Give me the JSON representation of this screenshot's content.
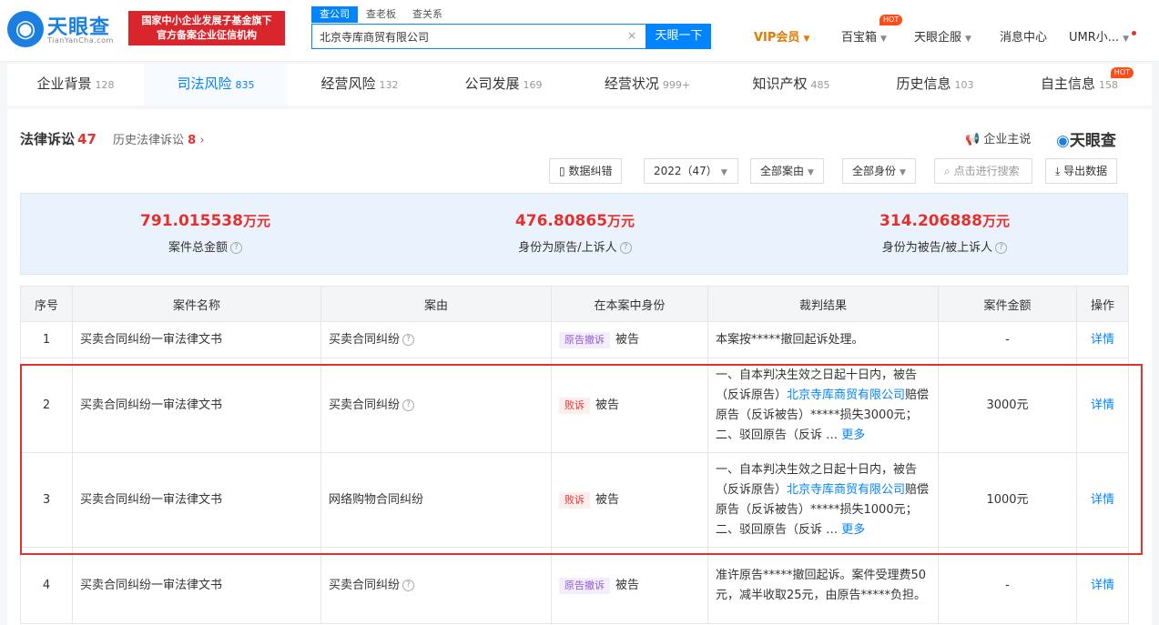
{
  "header": {
    "logo_mark": "◉",
    "logo_text": "天眼查",
    "logo_sub": "TianYanCha.com",
    "badge_line1": "国家中小企业发展子基金旗下",
    "badge_line2": "官方备案企业征信机构",
    "search_tabs": [
      "查公司",
      "查老板",
      "查关系"
    ],
    "search_value": "北京寺库商贸有限公司",
    "search_button": "天眼一下",
    "nav": {
      "vip": "VIP会员",
      "treasure": "百宝箱",
      "hot": "HOT",
      "enterprise": "天眼企服",
      "messages": "消息中心",
      "user": "UMR小..."
    }
  },
  "tabs": [
    {
      "label": "企业背景",
      "count": "128"
    },
    {
      "label": "司法风险",
      "count": "835"
    },
    {
      "label": "经营风险",
      "count": "132"
    },
    {
      "label": "公司发展",
      "count": "169"
    },
    {
      "label": "经营状况",
      "count": "999+"
    },
    {
      "label": "知识产权",
      "count": "485"
    },
    {
      "label": "历史信息",
      "count": "103"
    },
    {
      "label": "自主信息",
      "count": "158",
      "hot": "HOT"
    }
  ],
  "section": {
    "title": "法律诉讼",
    "count": "47",
    "history_label": "历史法律诉讼",
    "history_count": "8",
    "brand_promo": "企业主说",
    "brand_logo": "天眼查"
  },
  "toolbar": {
    "correction": "数据纠错",
    "year": "2022（47）",
    "cause": "全部案由",
    "identity": "全部身份",
    "search_placeholder": "点击进行搜索",
    "export": "导出数据"
  },
  "stats": [
    {
      "value": "791.015538",
      "unit": "万元",
      "label": "案件总金额"
    },
    {
      "value": "476.80865",
      "unit": "万元",
      "label": "身份为原告/上诉人"
    },
    {
      "value": "314.206888",
      "unit": "万元",
      "label": "身份为被告/被上诉人"
    }
  ],
  "table": {
    "headers": [
      "序号",
      "案件名称",
      "案由",
      "在本案中身份",
      "裁判结果",
      "案件金额",
      "操作"
    ],
    "rows": [
      {
        "no": "1",
        "name": "买卖合同纠纷一审法律文书",
        "cause": "买卖合同纠纷",
        "tag": "原告撤诉",
        "role": "被告",
        "result": "本案按*****撤回起诉处理。",
        "amount": "-",
        "action": "详情"
      },
      {
        "no": "2",
        "name": "买卖合同纠纷一审法律文书",
        "cause": "买卖合同纠纷",
        "tag": "败诉",
        "role": "被告",
        "result_a": "一、自本判决生效之日起十日内，被告（反诉原告）",
        "result_link": "北京寺库商贸有限公司",
        "result_b": "赔偿原告（反诉被告）*****损失3000元；二、驳回原告（反诉",
        "more": "更多",
        "amount": "3000元",
        "action": "详情"
      },
      {
        "no": "3",
        "name": "买卖合同纠纷一审法律文书",
        "cause": "网络购物合同纠纷",
        "tag": "败诉",
        "role": "被告",
        "result_a": "一、自本判决生效之日起十日内，被告（反诉原告）",
        "result_link": "北京寺库商贸有限公司",
        "result_b": "赔偿原告（反诉被告）*****损失1000元；二、驳回原告（反诉",
        "more": "更多",
        "amount": "1000元",
        "action": "详情"
      },
      {
        "no": "4",
        "name": "买卖合同纠纷一审法律文书",
        "cause": "买卖合同纠纷",
        "tag": "原告撤诉",
        "role": "被告",
        "result": "准许原告*****撤回起诉。案件受理费50元，减半收取25元，由原告*****负担。",
        "amount": "-",
        "action": "详情"
      }
    ]
  },
  "colors": {
    "accent": "#0084ff",
    "danger": "#e5312e",
    "vip": "#e07b00"
  }
}
